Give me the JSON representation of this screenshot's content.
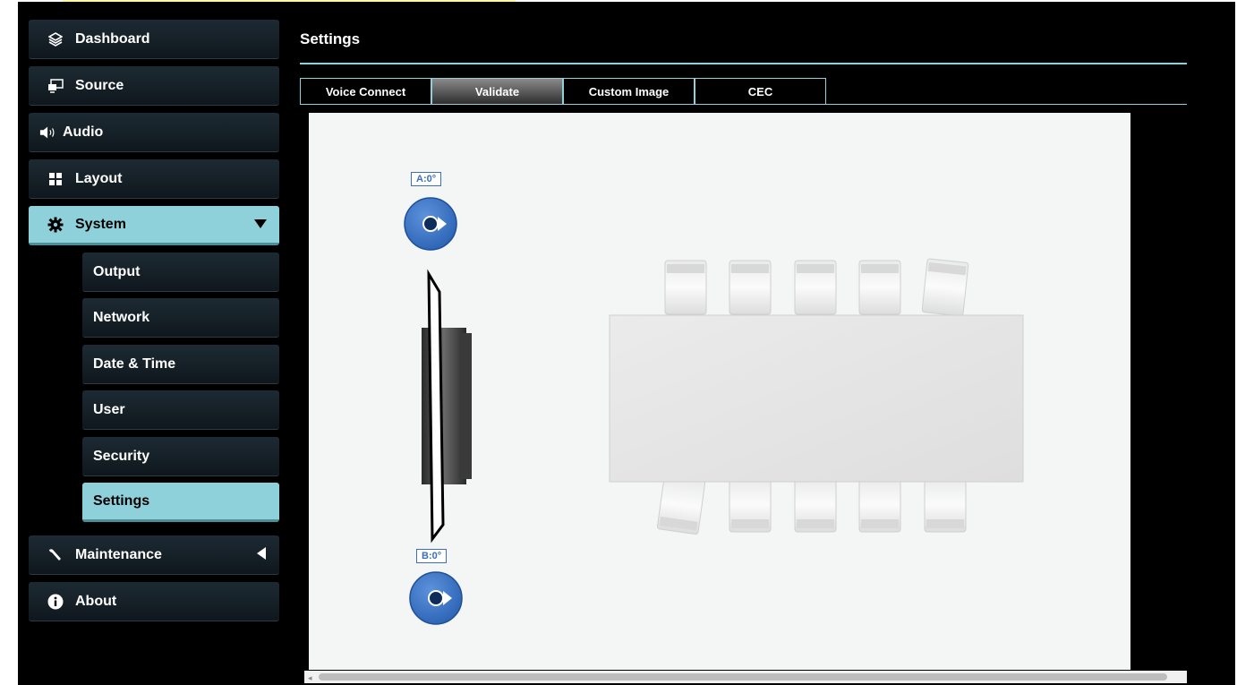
{
  "sidebar": {
    "items": [
      {
        "label": "Dashboard",
        "icon": "layers-icon"
      },
      {
        "label": "Source",
        "icon": "source-icon"
      },
      {
        "label": "Audio",
        "icon": "speaker-icon"
      },
      {
        "label": "Layout",
        "icon": "grid-icon"
      },
      {
        "label": "System",
        "icon": "gear-icon",
        "expanded": true
      },
      {
        "label": "Maintenance",
        "icon": "wrench-icon",
        "expanded": false
      },
      {
        "label": "About",
        "icon": "info-icon"
      }
    ],
    "system_sub": [
      {
        "label": "Output"
      },
      {
        "label": "Network"
      },
      {
        "label": "Date & Time"
      },
      {
        "label": "User"
      },
      {
        "label": "Security"
      },
      {
        "label": "Settings",
        "active": true
      }
    ]
  },
  "main": {
    "title": "Settings",
    "tabs": [
      {
        "label": "Voice Connect"
      },
      {
        "label": "Validate",
        "active": true
      },
      {
        "label": "Custom Image"
      },
      {
        "label": "CEC"
      }
    ],
    "mics": [
      {
        "label": "A:0°"
      },
      {
        "label": "B:0°"
      }
    ]
  },
  "colors": {
    "accent": "#8fd1da",
    "mic_blue": "#3b6fb6",
    "background": "#000000"
  }
}
